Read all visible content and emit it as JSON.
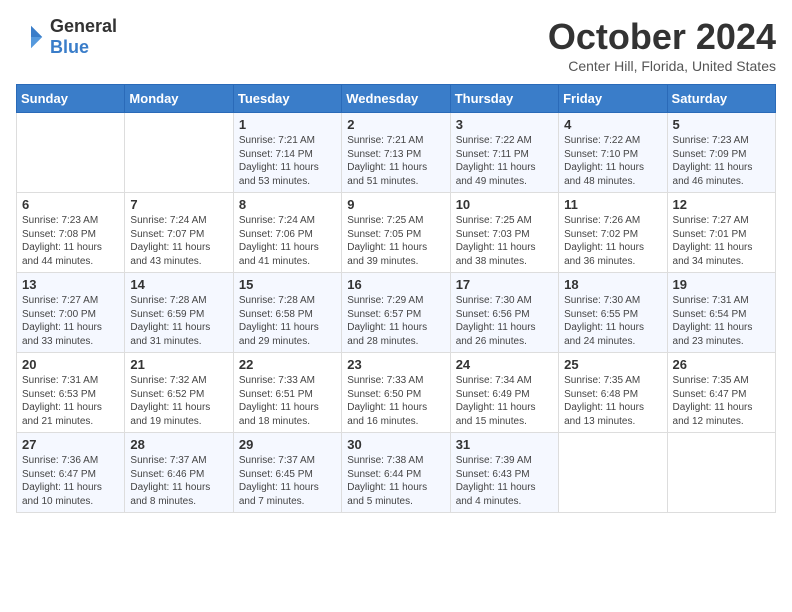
{
  "header": {
    "logo_general": "General",
    "logo_blue": "Blue",
    "month_title": "October 2024",
    "location": "Center Hill, Florida, United States"
  },
  "days_of_week": [
    "Sunday",
    "Monday",
    "Tuesday",
    "Wednesday",
    "Thursday",
    "Friday",
    "Saturday"
  ],
  "weeks": [
    [
      {
        "day": "",
        "info": ""
      },
      {
        "day": "",
        "info": ""
      },
      {
        "day": "1",
        "info": "Sunrise: 7:21 AM\nSunset: 7:14 PM\nDaylight: 11 hours and 53 minutes."
      },
      {
        "day": "2",
        "info": "Sunrise: 7:21 AM\nSunset: 7:13 PM\nDaylight: 11 hours and 51 minutes."
      },
      {
        "day": "3",
        "info": "Sunrise: 7:22 AM\nSunset: 7:11 PM\nDaylight: 11 hours and 49 minutes."
      },
      {
        "day": "4",
        "info": "Sunrise: 7:22 AM\nSunset: 7:10 PM\nDaylight: 11 hours and 48 minutes."
      },
      {
        "day": "5",
        "info": "Sunrise: 7:23 AM\nSunset: 7:09 PM\nDaylight: 11 hours and 46 minutes."
      }
    ],
    [
      {
        "day": "6",
        "info": "Sunrise: 7:23 AM\nSunset: 7:08 PM\nDaylight: 11 hours and 44 minutes."
      },
      {
        "day": "7",
        "info": "Sunrise: 7:24 AM\nSunset: 7:07 PM\nDaylight: 11 hours and 43 minutes."
      },
      {
        "day": "8",
        "info": "Sunrise: 7:24 AM\nSunset: 7:06 PM\nDaylight: 11 hours and 41 minutes."
      },
      {
        "day": "9",
        "info": "Sunrise: 7:25 AM\nSunset: 7:05 PM\nDaylight: 11 hours and 39 minutes."
      },
      {
        "day": "10",
        "info": "Sunrise: 7:25 AM\nSunset: 7:03 PM\nDaylight: 11 hours and 38 minutes."
      },
      {
        "day": "11",
        "info": "Sunrise: 7:26 AM\nSunset: 7:02 PM\nDaylight: 11 hours and 36 minutes."
      },
      {
        "day": "12",
        "info": "Sunrise: 7:27 AM\nSunset: 7:01 PM\nDaylight: 11 hours and 34 minutes."
      }
    ],
    [
      {
        "day": "13",
        "info": "Sunrise: 7:27 AM\nSunset: 7:00 PM\nDaylight: 11 hours and 33 minutes."
      },
      {
        "day": "14",
        "info": "Sunrise: 7:28 AM\nSunset: 6:59 PM\nDaylight: 11 hours and 31 minutes."
      },
      {
        "day": "15",
        "info": "Sunrise: 7:28 AM\nSunset: 6:58 PM\nDaylight: 11 hours and 29 minutes."
      },
      {
        "day": "16",
        "info": "Sunrise: 7:29 AM\nSunset: 6:57 PM\nDaylight: 11 hours and 28 minutes."
      },
      {
        "day": "17",
        "info": "Sunrise: 7:30 AM\nSunset: 6:56 PM\nDaylight: 11 hours and 26 minutes."
      },
      {
        "day": "18",
        "info": "Sunrise: 7:30 AM\nSunset: 6:55 PM\nDaylight: 11 hours and 24 minutes."
      },
      {
        "day": "19",
        "info": "Sunrise: 7:31 AM\nSunset: 6:54 PM\nDaylight: 11 hours and 23 minutes."
      }
    ],
    [
      {
        "day": "20",
        "info": "Sunrise: 7:31 AM\nSunset: 6:53 PM\nDaylight: 11 hours and 21 minutes."
      },
      {
        "day": "21",
        "info": "Sunrise: 7:32 AM\nSunset: 6:52 PM\nDaylight: 11 hours and 19 minutes."
      },
      {
        "day": "22",
        "info": "Sunrise: 7:33 AM\nSunset: 6:51 PM\nDaylight: 11 hours and 18 minutes."
      },
      {
        "day": "23",
        "info": "Sunrise: 7:33 AM\nSunset: 6:50 PM\nDaylight: 11 hours and 16 minutes."
      },
      {
        "day": "24",
        "info": "Sunrise: 7:34 AM\nSunset: 6:49 PM\nDaylight: 11 hours and 15 minutes."
      },
      {
        "day": "25",
        "info": "Sunrise: 7:35 AM\nSunset: 6:48 PM\nDaylight: 11 hours and 13 minutes."
      },
      {
        "day": "26",
        "info": "Sunrise: 7:35 AM\nSunset: 6:47 PM\nDaylight: 11 hours and 12 minutes."
      }
    ],
    [
      {
        "day": "27",
        "info": "Sunrise: 7:36 AM\nSunset: 6:47 PM\nDaylight: 11 hours and 10 minutes."
      },
      {
        "day": "28",
        "info": "Sunrise: 7:37 AM\nSunset: 6:46 PM\nDaylight: 11 hours and 8 minutes."
      },
      {
        "day": "29",
        "info": "Sunrise: 7:37 AM\nSunset: 6:45 PM\nDaylight: 11 hours and 7 minutes."
      },
      {
        "day": "30",
        "info": "Sunrise: 7:38 AM\nSunset: 6:44 PM\nDaylight: 11 hours and 5 minutes."
      },
      {
        "day": "31",
        "info": "Sunrise: 7:39 AM\nSunset: 6:43 PM\nDaylight: 11 hours and 4 minutes."
      },
      {
        "day": "",
        "info": ""
      },
      {
        "day": "",
        "info": ""
      }
    ]
  ]
}
